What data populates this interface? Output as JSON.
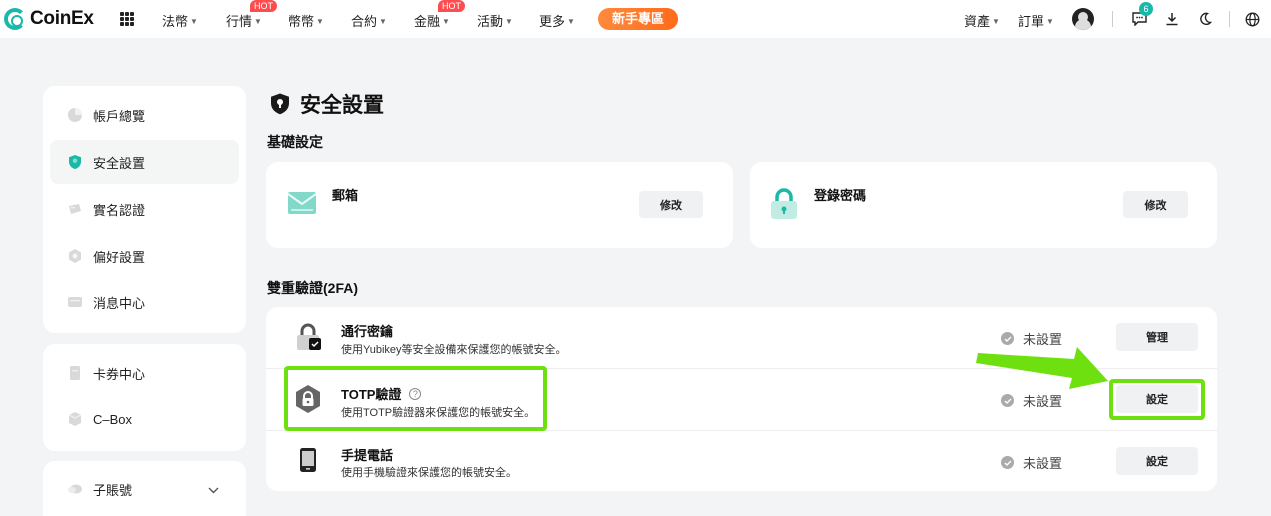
{
  "brand": {
    "name": "CoinEx",
    "accent": "#1ab8a7"
  },
  "nav": {
    "items": [
      {
        "label": "法幣",
        "hot": false
      },
      {
        "label": "行情",
        "hot": true
      },
      {
        "label": "幣幣",
        "hot": false
      },
      {
        "label": "合約",
        "hot": false
      },
      {
        "label": "金融",
        "hot": true
      },
      {
        "label": "活動",
        "hot": false
      },
      {
        "label": "更多",
        "hot": false
      }
    ],
    "hot_label": "HOT",
    "newbie_label": "新手專區",
    "assets_label": "資產",
    "orders_label": "訂單",
    "message_count": "6"
  },
  "sidebar": {
    "groups": [
      [
        {
          "label": "帳戶總覽",
          "icon": "pie-chart-icon",
          "active": false
        },
        {
          "label": "安全設置",
          "icon": "shield-icon",
          "active": true
        },
        {
          "label": "實名認證",
          "icon": "id-card-icon",
          "active": false
        },
        {
          "label": "偏好設置",
          "icon": "settings-icon",
          "active": false
        },
        {
          "label": "消息中心",
          "icon": "message-icon",
          "active": false
        }
      ],
      [
        {
          "label": "卡券中心",
          "icon": "coupon-icon",
          "active": false
        },
        {
          "label": "C–Box",
          "icon": "box-icon",
          "active": false
        }
      ],
      [
        {
          "label": "子賬號",
          "icon": "sub-account-icon",
          "active": false
        }
      ]
    ]
  },
  "main": {
    "title": "安全設置",
    "basic": {
      "title": "基礎設定",
      "cards": [
        {
          "label": "郵箱",
          "icon": "envelope-icon",
          "button": "修改"
        },
        {
          "label": "登錄密碼",
          "icon": "lock-icon",
          "button": "修改"
        }
      ]
    },
    "twofa": {
      "title": "雙重驗證(2FA)",
      "rows": [
        {
          "title": "通行密鑰",
          "desc": "使用Yubikey等安全設備來保護您的帳號安全。",
          "status": "未設置",
          "button": "管理",
          "icon": "passkey-icon",
          "help": false
        },
        {
          "title": "TOTP驗證",
          "desc": "使用TOTP驗證器來保護您的帳號安全。",
          "status": "未設置",
          "button": "設定",
          "icon": "totp-icon",
          "help": true
        },
        {
          "title": "手提電話",
          "desc": "使用手機驗證來保護您的帳號安全。",
          "status": "未設置",
          "button": "設定",
          "icon": "phone-icon",
          "help": false
        }
      ]
    }
  },
  "annotation": {
    "color": "#6ee00f"
  }
}
